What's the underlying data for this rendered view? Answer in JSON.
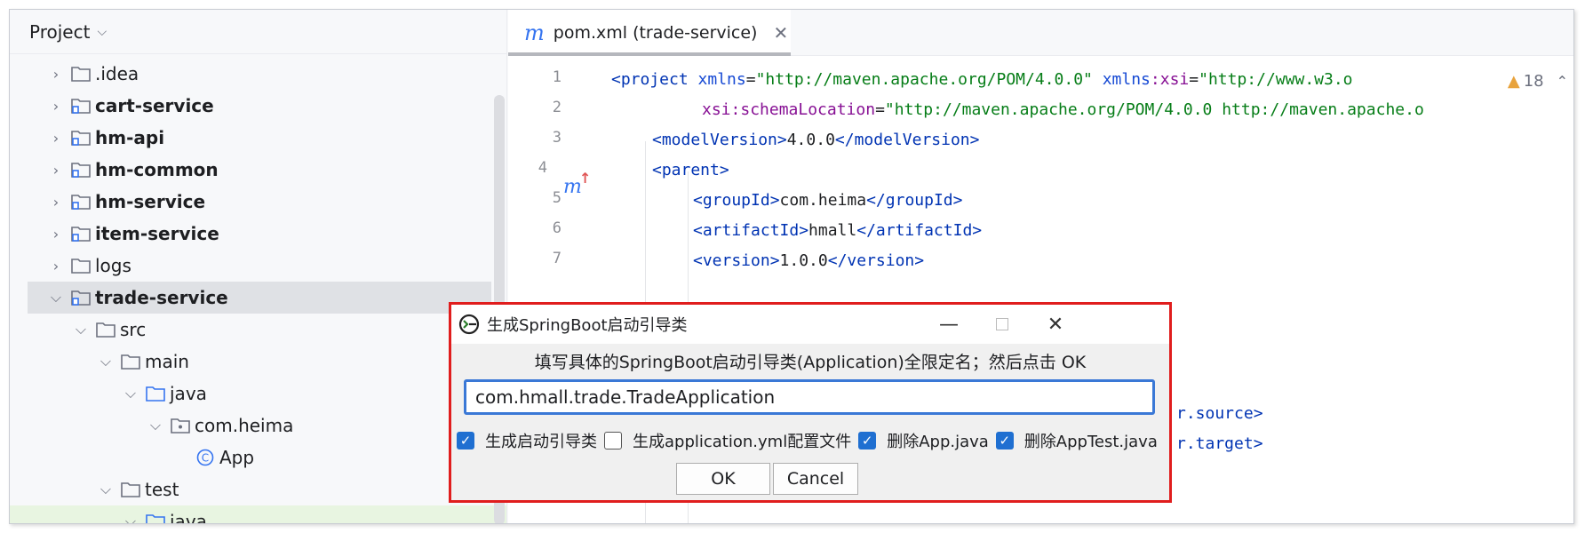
{
  "project_panel": {
    "title": "Project",
    "items": [
      {
        "label": ".idea",
        "indent": 0,
        "kind": "folder",
        "bold": false
      },
      {
        "label": "cart-service",
        "indent": 0,
        "kind": "module",
        "bold": true
      },
      {
        "label": "hm-api",
        "indent": 0,
        "kind": "module",
        "bold": true
      },
      {
        "label": "hm-common",
        "indent": 0,
        "kind": "module",
        "bold": true
      },
      {
        "label": "hm-service",
        "indent": 0,
        "kind": "module",
        "bold": true
      },
      {
        "label": "item-service",
        "indent": 0,
        "kind": "module",
        "bold": true
      },
      {
        "label": "logs",
        "indent": 0,
        "kind": "folder",
        "bold": false
      },
      {
        "label": "trade-service",
        "indent": 0,
        "kind": "module",
        "bold": true
      },
      {
        "label": "src",
        "indent": 1,
        "kind": "folder",
        "bold": false
      },
      {
        "label": "main",
        "indent": 2,
        "kind": "folder",
        "bold": false
      },
      {
        "label": "java",
        "indent": 3,
        "kind": "source",
        "bold": false
      },
      {
        "label": "com.heima",
        "indent": 4,
        "kind": "package",
        "bold": false
      },
      {
        "label": "App",
        "indent": 5,
        "kind": "class",
        "bold": false
      },
      {
        "label": "test",
        "indent": 2,
        "kind": "folder",
        "bold": false
      },
      {
        "label": "java",
        "indent": 3,
        "kind": "source",
        "bold": false
      }
    ]
  },
  "editor": {
    "tab_label": "pom.xml (trade-service)",
    "tab_icon": "maven-icon",
    "warning_count": "18",
    "line_numbers": [
      "1",
      "2",
      "3",
      "4",
      "5",
      "6",
      "7"
    ],
    "code": {
      "l1_tag": "<project ",
      "l1_attr1": "xmlns",
      "l1_eq1": "=",
      "l1_val1": "\"http://maven.apache.org/POM/4.0.0\"",
      "l1_attr2": " xmlns",
      "l1_ns": ":xsi",
      "l1_eq2": "=",
      "l1_val2": "\"http://www.w3.o",
      "l2_ns": "xsi",
      "l2_attr": ":schemaLocation",
      "l2_eq": "=",
      "l2_val": "\"http://maven.apache.org/POM/4.0.0 http://maven.apache.o",
      "l3_open": "<modelVersion>",
      "l3_text": "4.0.0",
      "l3_close": "</modelVersion>",
      "l4_open": "<parent>",
      "l5_open": "<groupId>",
      "l5_text": "com.heima",
      "l5_close": "</groupId>",
      "l6_open": "<artifactId>",
      "l6_text": "hmall",
      "l6_close": "</artifactId>",
      "l7_open": "<version>",
      "l7_text": "1.0.0",
      "l7_close": "</version>",
      "l11_frag": "r.source>",
      "l12_frag": "r.target>"
    }
  },
  "dialog": {
    "title": "生成SpringBoot启动引导类",
    "prompt": "填写具体的SpringBoot启动引导类(Application)全限定名；然后点击 OK",
    "input_value": "com.hmall.trade.TradeApplication",
    "options": [
      {
        "label": "生成启动引导类",
        "checked": true
      },
      {
        "label": "生成application.yml配置文件",
        "checked": false
      },
      {
        "label": "删除App.java",
        "checked": true
      },
      {
        "label": "删除AppTest.java",
        "checked": true
      }
    ],
    "ok_label": "OK",
    "cancel_label": "Cancel"
  }
}
